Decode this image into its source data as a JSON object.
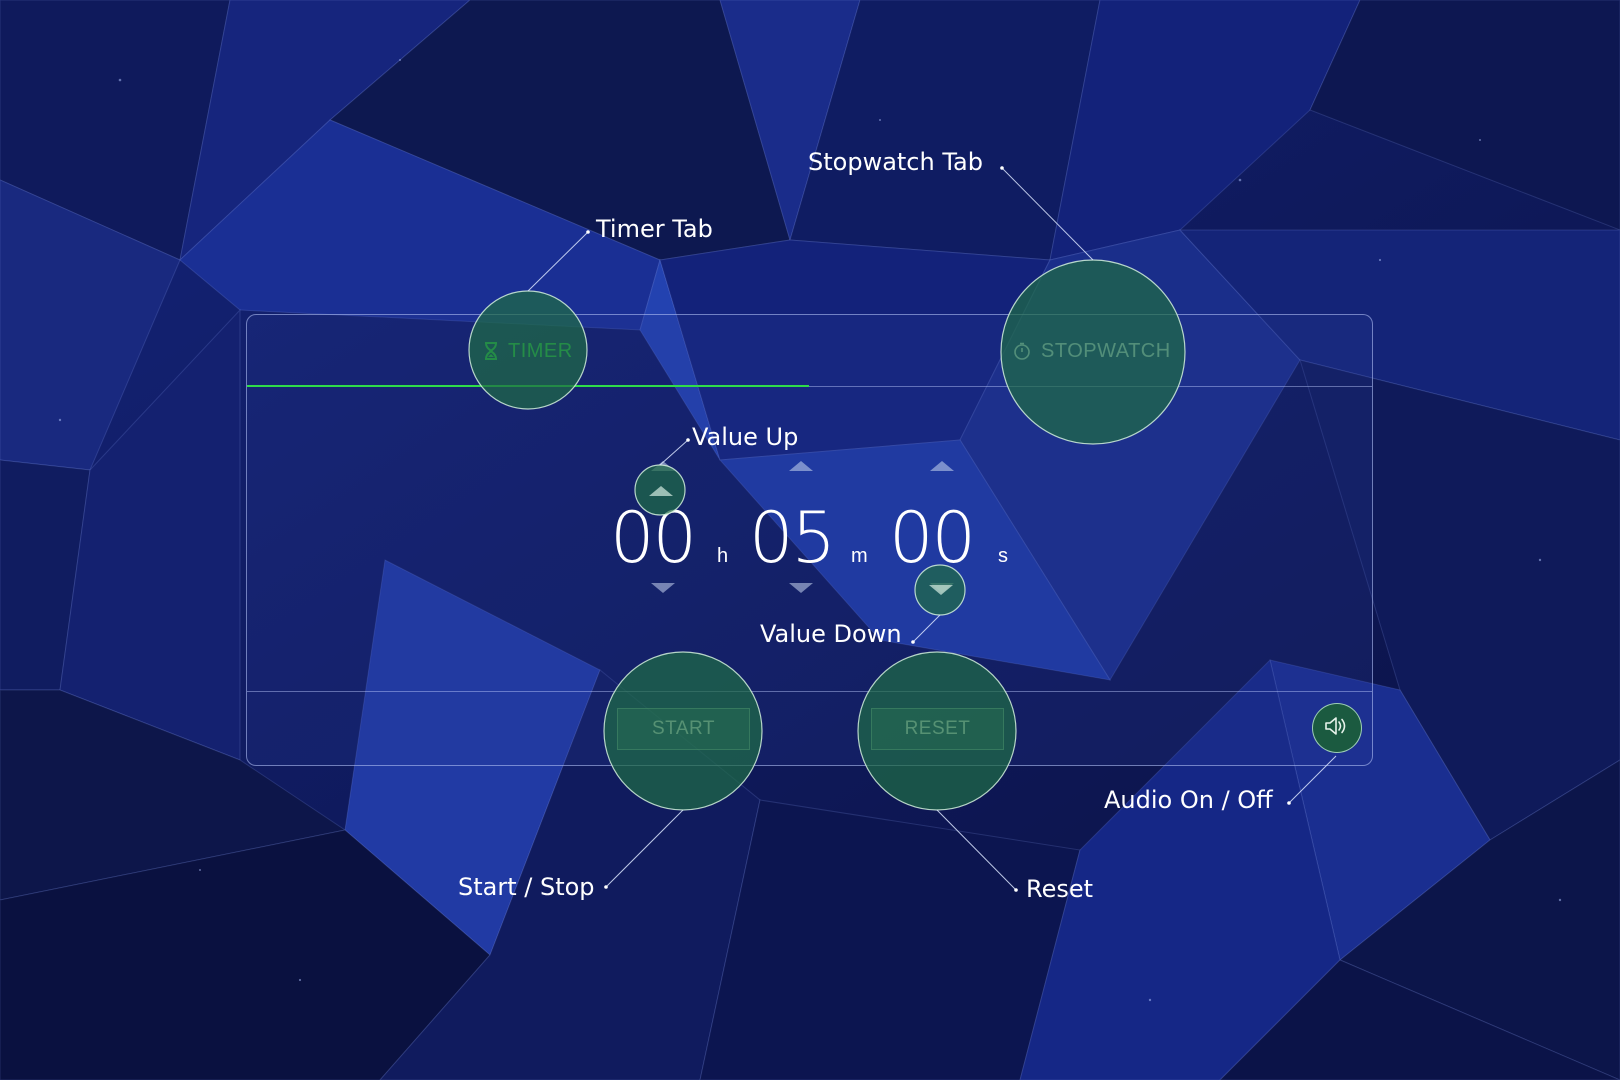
{
  "tabs": [
    {
      "label": "TIMER",
      "icon": "hourglass-icon",
      "active": true
    },
    {
      "label": "STOPWATCH",
      "icon": "stopwatch-icon",
      "active": false
    }
  ],
  "timer": {
    "hours": "00",
    "hours_unit": "h",
    "minutes": "05",
    "minutes_unit": "m",
    "seconds": "00",
    "seconds_unit": "s"
  },
  "controls": {
    "start_label": "START",
    "reset_label": "RESET",
    "audio_icon": "speaker-icon"
  },
  "annotations": {
    "timer_tab": "Timer Tab",
    "stopwatch_tab": "Stopwatch Tab",
    "value_up": "Value Up",
    "value_down": "Value Down",
    "start_stop": "Start / Stop",
    "reset": "Reset",
    "audio": "Audio On / Off"
  },
  "colors": {
    "active_tab": "#34e24d",
    "highlight": "#1f6b45",
    "background": "#0c1446"
  }
}
